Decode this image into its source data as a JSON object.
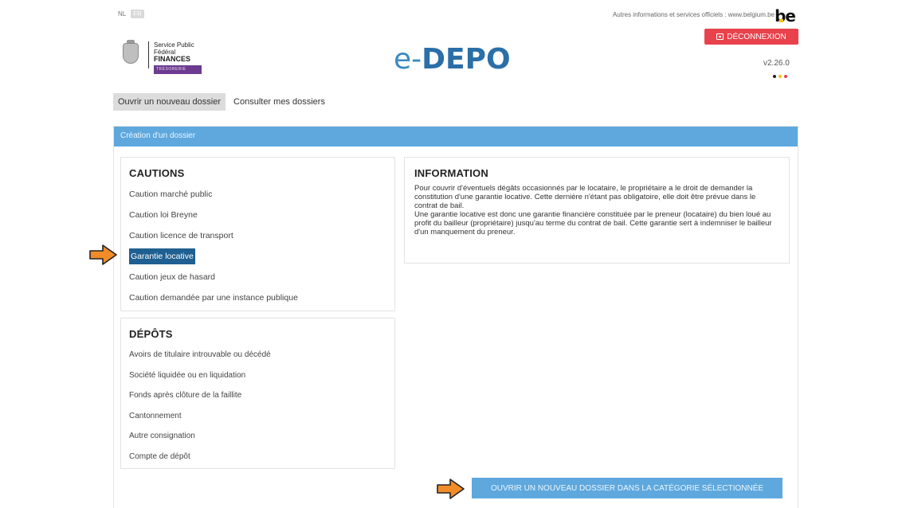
{
  "topbar": {
    "lang_nl": "NL",
    "lang_fr": "FR",
    "official_link": "Autres informations et services officiels : www.belgium.be",
    "be_logo": "be"
  },
  "header": {
    "logo": {
      "line1": "Service Public",
      "line2": "Fédéral",
      "line3": "FINANCES",
      "line4": "TRÉSORERIE"
    },
    "title_prefix": "e-",
    "title_main": "DEPO",
    "logout_label": "DÉCONNEXION",
    "version": "v2.26.0",
    "dot_colors": [
      "#222222",
      "#f5c400",
      "#e8424c"
    ]
  },
  "nav": {
    "tabs": [
      {
        "label": "Ouvrir un nouveau dossier",
        "active": true
      },
      {
        "label": "Consulter mes dossiers",
        "active": false
      }
    ]
  },
  "panel": {
    "header": "Création d'un dossier",
    "cautions": {
      "title": "CAUTIONS",
      "items": [
        "Caution marché public",
        "Caution loi Breyne",
        "Caution licence de transport",
        "Garantie locative",
        "Caution jeux de hasard",
        "Caution demandée par une instance publique"
      ],
      "selected_index": 3
    },
    "depots": {
      "title": "DÉPÔTS",
      "items": [
        "Avoirs de titulaire introuvable ou décédé",
        "Société liquidée ou en liquidation",
        "Fonds après clôture de la faillite",
        "Cantonnement",
        "Autre consignation",
        "Compte de dépôt"
      ]
    },
    "information": {
      "title": "INFORMATION",
      "paragraph1": "Pour couvrir d'éventuels dégâts occasionnés par le locataire, le propriétaire a le droit de demander la constitution d'une garantie locative. Cette dernière n'étant pas obligatoire, elle doit être prévue dans le contrat de bail.",
      "paragraph2": "Une garantie locative est donc une garantie financière constituée par le preneur (locataire) du bien loué au profit du bailleur (propriétaire) jusqu'au terme du contrat de bail. Cette garantie sert à indemniser le bailleur d'un manquement du preneur."
    },
    "open_button": "OUVRIR UN NOUVEAU DOSSIER DANS LA CATÉGORIE SÉLECTIONNÉE"
  },
  "colors": {
    "accent_blue": "#5ea8de",
    "selected_blue": "#1f5f91",
    "logout_red": "#e8424c",
    "arrow_orange": "#f28c28"
  }
}
